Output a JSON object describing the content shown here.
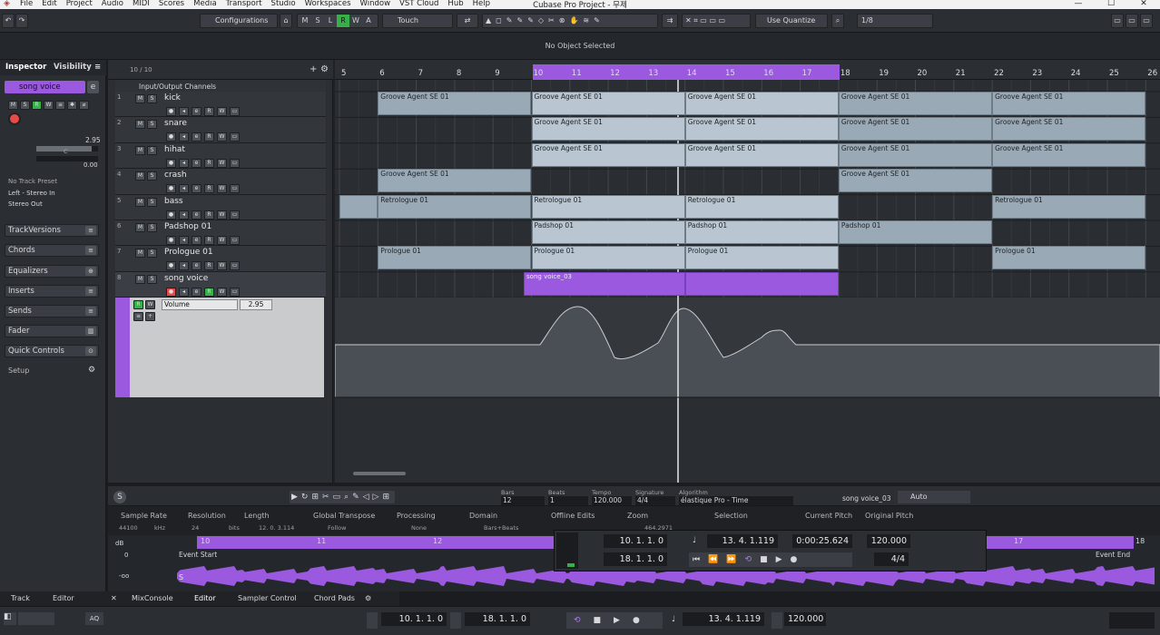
{
  "menubar": {
    "items": [
      "File",
      "Edit",
      "Project",
      "Audio",
      "MIDI",
      "Scores",
      "Media",
      "Transport",
      "Studio",
      "Workspaces",
      "Window",
      "VST Cloud",
      "Hub",
      "Help"
    ],
    "window_title": "Cubase Pro Project - 무제",
    "ctrl_min": "—",
    "ctrl_max": "☐",
    "ctrl_close": "✕"
  },
  "toolbar": {
    "configurations": "Configurations",
    "automation_mode": "Touch",
    "quantize": "Use Quantize",
    "grid": "1/8",
    "msrwa": [
      "M",
      "S",
      "L",
      "R",
      "W",
      "A"
    ]
  },
  "status": {
    "text": "No Object Selected"
  },
  "inspector": {
    "tab_inspector": "Inspector",
    "tab_visibility": "Visibility",
    "track_name": "song voice",
    "volume": "2.95",
    "pan_label": "C",
    "pan": "0.00",
    "preset": "No Track Preset",
    "input": "Left - Stereo In",
    "output": "Stereo Out",
    "sections": [
      "TrackVersions",
      "Chords",
      "Equalizers",
      "Inserts",
      "Sends",
      "Fader",
      "Quick Controls"
    ],
    "setup": "Setup"
  },
  "tracklist": {
    "count": "10 / 10",
    "folder": "Input/Output Channels",
    "tracks": [
      {
        "num": "1",
        "name": "kick"
      },
      {
        "num": "2",
        "name": "snare"
      },
      {
        "num": "3",
        "name": "hihat"
      },
      {
        "num": "4",
        "name": "crash"
      },
      {
        "num": "5",
        "name": "bass"
      },
      {
        "num": "6",
        "name": "Padshop 01"
      },
      {
        "num": "7",
        "name": "Prologue 01"
      },
      {
        "num": "8",
        "name": "song voice"
      }
    ],
    "automation_param": "Volume",
    "automation_value": "2.95"
  },
  "ruler": {
    "bars": [
      "5",
      "6",
      "7",
      "8",
      "9",
      "10",
      "11",
      "12",
      "13",
      "14",
      "15",
      "16",
      "17",
      "18",
      "19",
      "20",
      "21",
      "22",
      "23",
      "24",
      "25",
      "26"
    ]
  },
  "parts": [
    {
      "lane": 0,
      "from": 6,
      "to": 10,
      "label": "Groove Agent SE 01"
    },
    {
      "lane": 0,
      "from": 10,
      "to": 14,
      "label": "Groove Agent SE 01"
    },
    {
      "lane": 0,
      "from": 14,
      "to": 18,
      "label": "Groove Agent SE 01"
    },
    {
      "lane": 0,
      "from": 18,
      "to": 22,
      "label": "Groove Agent SE 01"
    },
    {
      "lane": 0,
      "from": 22,
      "to": 26,
      "label": "Groove Agent SE 01"
    },
    {
      "lane": 1,
      "from": 10,
      "to": 14,
      "label": "Groove Agent SE 01"
    },
    {
      "lane": 1,
      "from": 14,
      "to": 18,
      "label": "Groove Agent SE 01"
    },
    {
      "lane": 1,
      "from": 18,
      "to": 22,
      "label": "Groove Agent SE 01"
    },
    {
      "lane": 1,
      "from": 22,
      "to": 26,
      "label": "Groove Agent SE 01"
    },
    {
      "lane": 2,
      "from": 10,
      "to": 14,
      "label": "Groove Agent SE 01"
    },
    {
      "lane": 2,
      "from": 14,
      "to": 18,
      "label": "Groove Agent SE 01"
    },
    {
      "lane": 2,
      "from": 18,
      "to": 22,
      "label": "Groove Agent SE 01"
    },
    {
      "lane": 2,
      "from": 22,
      "to": 26,
      "label": "Groove Agent SE 01"
    },
    {
      "lane": 3,
      "from": 6,
      "to": 10,
      "label": "Groove Agent SE 01"
    },
    {
      "lane": 3,
      "from": 18,
      "to": 22,
      "label": "Groove Agent SE 01"
    },
    {
      "lane": 4,
      "from": 5,
      "to": 6,
      "label": ""
    },
    {
      "lane": 4,
      "from": 6,
      "to": 10,
      "label": "Retrologue 01"
    },
    {
      "lane": 4,
      "from": 10,
      "to": 14,
      "label": "Retrologue 01"
    },
    {
      "lane": 4,
      "from": 14,
      "to": 18,
      "label": "Retrologue 01"
    },
    {
      "lane": 4,
      "from": 22,
      "to": 26,
      "label": "Retrologue 01"
    },
    {
      "lane": 5,
      "from": 10,
      "to": 14,
      "label": "Padshop 01"
    },
    {
      "lane": 5,
      "from": 14,
      "to": 18,
      "label": "Padshop 01"
    },
    {
      "lane": 5,
      "from": 18,
      "to": 22,
      "label": "Padshop 01"
    },
    {
      "lane": 6,
      "from": 6,
      "to": 10,
      "label": "Prologue 01"
    },
    {
      "lane": 6,
      "from": 10,
      "to": 14,
      "label": "Prologue 01"
    },
    {
      "lane": 6,
      "from": 14,
      "to": 18,
      "label": "Prologue 01"
    },
    {
      "lane": 6,
      "from": 22,
      "to": 26,
      "label": "Prologue 01"
    }
  ],
  "audio_event": {
    "label": "song voice_03"
  },
  "sample_editor": {
    "bars_label": "Bars",
    "bars": "12",
    "beats_label": "Beats",
    "beats": "1",
    "tempo_label": "Tempo",
    "tempo": "120.000",
    "sig_label": "Signature",
    "sig": "4/4",
    "algo_label": "Algorithm",
    "algo": "élastique Pro - Time",
    "event_name": "song voice_03",
    "auto": "Auto",
    "info": [
      {
        "h": "Sample Rate",
        "v": "44100"
      },
      {
        "h": "Resolution",
        "v": "24"
      },
      {
        "h": "Length",
        "v": "12. 0. 3.114"
      },
      {
        "h": "Global Transpose",
        "v": "Follow"
      },
      {
        "h": "Processing",
        "v": "None"
      },
      {
        "h": "Domain",
        "v": "Bars+Beats"
      },
      {
        "h": "Offline Edits",
        "v": ""
      },
      {
        "h": "Zoom",
        "v": ""
      },
      {
        "h": "Selection",
        "v": ""
      },
      {
        "h": "Current Pitch",
        "v": ""
      },
      {
        "h": "Original Pitch",
        "v": ""
      }
    ],
    "units": {
      "khz": "kHz",
      "bits": "bits"
    },
    "zoom_val": "464.2971",
    "ruler": [
      "10",
      "11",
      "12",
      "17",
      "18"
    ],
    "event_start": "Event Start",
    "event_end": "Event End",
    "db": "dB",
    "inf": "-oo",
    "zero": "0"
  },
  "mini_transport": {
    "left": "10. 1. 1.   0",
    "right": "18. 1. 1.   0",
    "pos": "13. 4. 1.119",
    "time": "0:00:25.624",
    "tempo": "120.000",
    "sig": "4/4"
  },
  "bottom_tabs": {
    "track": "Track",
    "editor": "Editor",
    "mixconsole": "MixConsole",
    "editor2": "Editor",
    "sampler": "Sampler Control",
    "chordpads": "Chord Pads"
  },
  "transport": {
    "left": "10. 1. 1.   0",
    "right": "18. 1. 1.   0",
    "pos": "13. 4. 1.119",
    "tempo": "120.000"
  },
  "colors": {
    "accent": "#9b59e0",
    "record": "#e84a4a",
    "green": "#38b04a"
  }
}
